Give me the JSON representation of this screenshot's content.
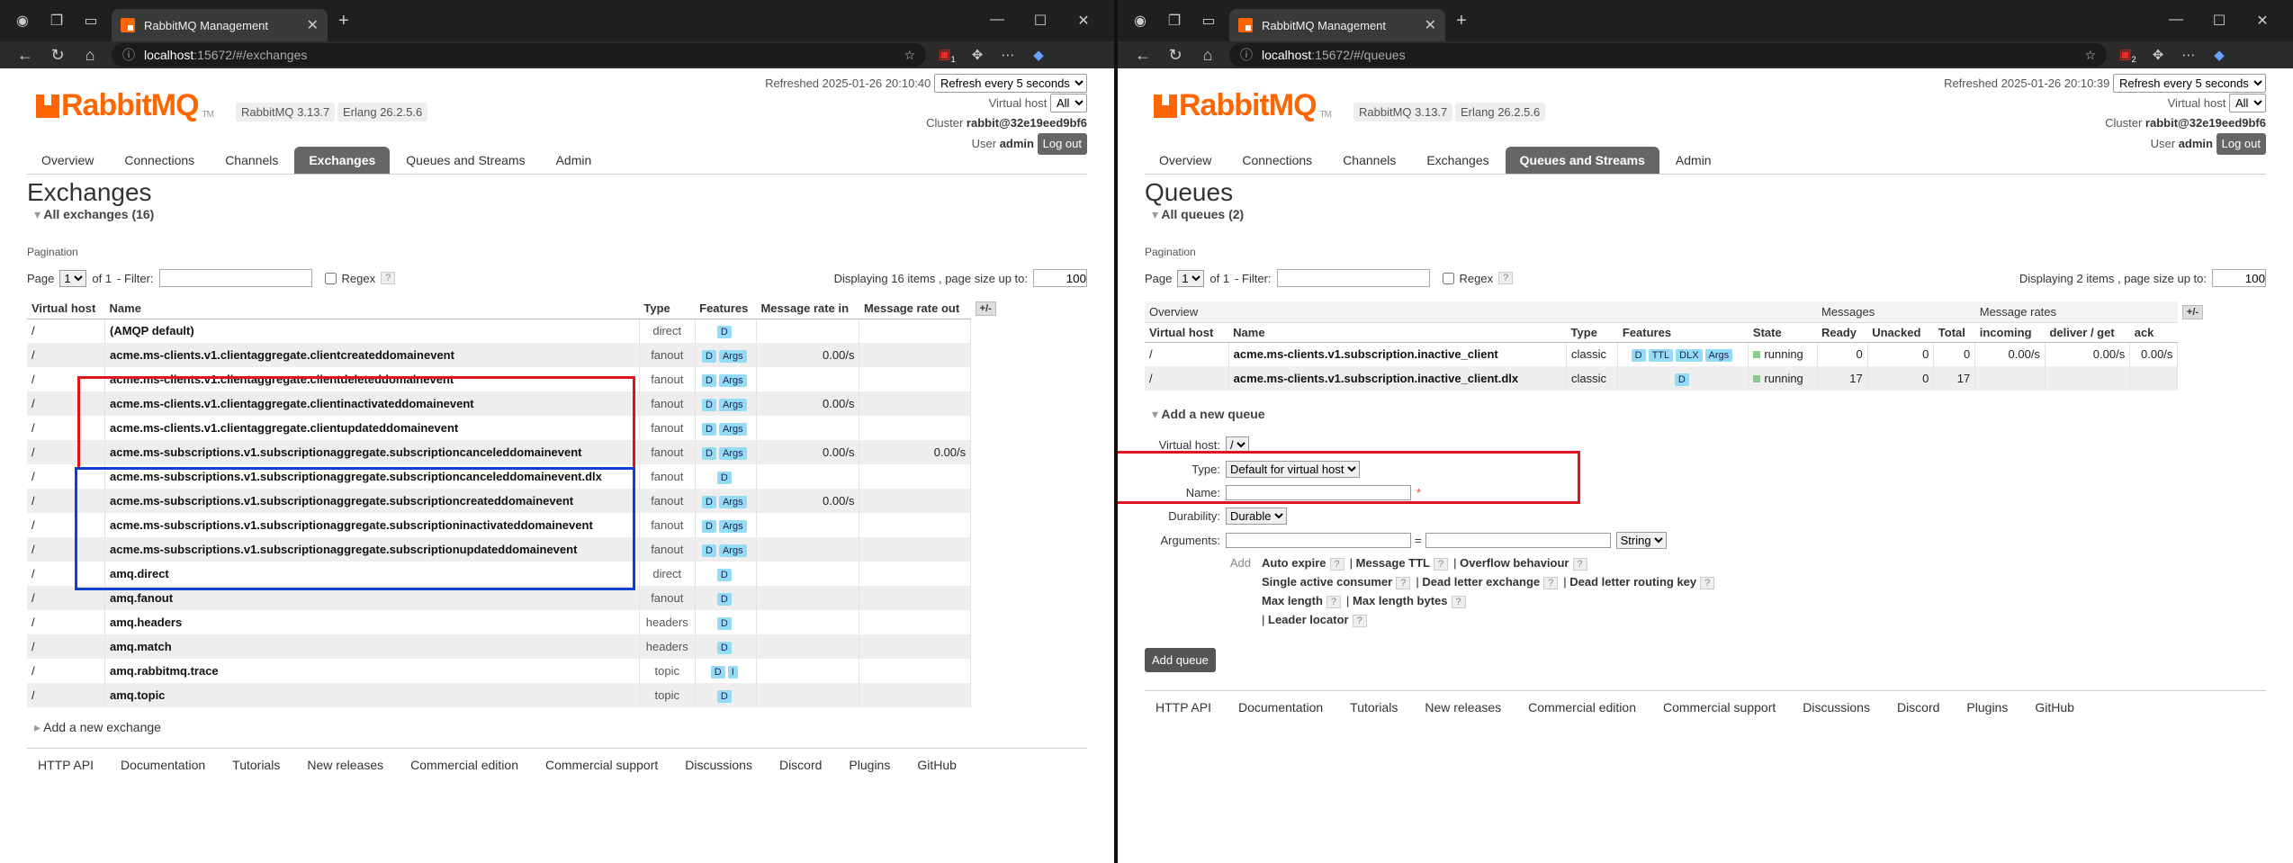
{
  "left": {
    "tab_title": "RabbitMQ Management",
    "url_host": "localhost",
    "url_rest": ":15672/#/exchanges",
    "ext_badge": "1",
    "version": "RabbitMQ 3.13.7",
    "erlang": "Erlang 26.2.5.6",
    "refreshed": "Refreshed 2025-01-26 20:10:40",
    "refresh_option": "Refresh every 5 seconds",
    "vhost_label": "Virtual host",
    "vhost_option": "All",
    "cluster_label": "Cluster",
    "cluster": "rabbit@32e19eed9bf6",
    "user_label": "User",
    "user": "admin",
    "logout": "Log out",
    "nav": [
      "Overview",
      "Connections",
      "Channels",
      "Exchanges",
      "Queues and Streams",
      "Admin"
    ],
    "page_title": "Exchanges",
    "section": "All exchanges (16)",
    "pagination": "Pagination",
    "page_label": "Page",
    "page_value": "1",
    "of_label": "of 1",
    "filter_label": "- Filter:",
    "regex_label": "Regex",
    "q": "?",
    "display_text": "Displaying 16 items , page size up to:",
    "page_size": "100",
    "columns": [
      "Virtual host",
      "Name",
      "Type",
      "Features",
      "Message rate in",
      "Message rate out",
      "+/-"
    ],
    "rows": [
      {
        "vh": "/",
        "name": "(AMQP default)",
        "type": "direct",
        "f": [
          "D"
        ],
        "in": "",
        "out": ""
      },
      {
        "vh": "/",
        "name": "acme.ms-clients.v1.clientaggregate.clientcreateddomainevent",
        "type": "fanout",
        "f": [
          "D",
          "Args"
        ],
        "in": "0.00/s",
        "out": ""
      },
      {
        "vh": "/",
        "name": "acme.ms-clients.v1.clientaggregate.clientdeleteddomainevent",
        "type": "fanout",
        "f": [
          "D",
          "Args"
        ],
        "in": "",
        "out": ""
      },
      {
        "vh": "/",
        "name": "acme.ms-clients.v1.clientaggregate.clientinactivateddomainevent",
        "type": "fanout",
        "f": [
          "D",
          "Args"
        ],
        "in": "0.00/s",
        "out": ""
      },
      {
        "vh": "/",
        "name": "acme.ms-clients.v1.clientaggregate.clientupdateddomainevent",
        "type": "fanout",
        "f": [
          "D",
          "Args"
        ],
        "in": "",
        "out": ""
      },
      {
        "vh": "/",
        "name": "acme.ms-subscriptions.v1.subscriptionaggregate.subscriptioncanceleddomainevent",
        "type": "fanout",
        "f": [
          "D",
          "Args"
        ],
        "in": "0.00/s",
        "out": "0.00/s"
      },
      {
        "vh": "/",
        "name": "acme.ms-subscriptions.v1.subscriptionaggregate.subscriptioncanceleddomainevent.dlx",
        "type": "fanout",
        "f": [
          "D"
        ],
        "in": "",
        "out": ""
      },
      {
        "vh": "/",
        "name": "acme.ms-subscriptions.v1.subscriptionaggregate.subscriptioncreateddomainevent",
        "type": "fanout",
        "f": [
          "D",
          "Args"
        ],
        "in": "0.00/s",
        "out": ""
      },
      {
        "vh": "/",
        "name": "acme.ms-subscriptions.v1.subscriptionaggregate.subscriptioninactivateddomainevent",
        "type": "fanout",
        "f": [
          "D",
          "Args"
        ],
        "in": "",
        "out": ""
      },
      {
        "vh": "/",
        "name": "acme.ms-subscriptions.v1.subscriptionaggregate.subscriptionupdateddomainevent",
        "type": "fanout",
        "f": [
          "D",
          "Args"
        ],
        "in": "",
        "out": ""
      },
      {
        "vh": "/",
        "name": "amq.direct",
        "type": "direct",
        "f": [
          "D"
        ],
        "in": "",
        "out": ""
      },
      {
        "vh": "/",
        "name": "amq.fanout",
        "type": "fanout",
        "f": [
          "D"
        ],
        "in": "",
        "out": ""
      },
      {
        "vh": "/",
        "name": "amq.headers",
        "type": "headers",
        "f": [
          "D"
        ],
        "in": "",
        "out": ""
      },
      {
        "vh": "/",
        "name": "amq.match",
        "type": "headers",
        "f": [
          "D"
        ],
        "in": "",
        "out": ""
      },
      {
        "vh": "/",
        "name": "amq.rabbitmq.trace",
        "type": "topic",
        "f": [
          "D",
          "I"
        ],
        "in": "",
        "out": ""
      },
      {
        "vh": "/",
        "name": "amq.topic",
        "type": "topic",
        "f": [
          "D"
        ],
        "in": "",
        "out": ""
      }
    ],
    "add_exchange": "Add a new exchange",
    "footer": [
      "HTTP API",
      "Documentation",
      "Tutorials",
      "New releases",
      "Commercial edition",
      "Commercial support",
      "Discussions",
      "Discord",
      "Plugins",
      "GitHub"
    ]
  },
  "right": {
    "tab_title": "RabbitMQ Management",
    "url_host": "localhost",
    "url_rest": ":15672/#/queues",
    "ext_badge": "2",
    "version": "RabbitMQ 3.13.7",
    "erlang": "Erlang 26.2.5.6",
    "refreshed": "Refreshed 2025-01-26 20:10:39",
    "refresh_option": "Refresh every 5 seconds",
    "vhost_label": "Virtual host",
    "vhost_option": "All",
    "cluster_label": "Cluster",
    "cluster": "rabbit@32e19eed9bf6",
    "user_label": "User",
    "user": "admin",
    "logout": "Log out",
    "nav": [
      "Overview",
      "Connections",
      "Channels",
      "Exchanges",
      "Queues and Streams",
      "Admin"
    ],
    "page_title": "Queues",
    "section": "All queues (2)",
    "pagination": "Pagination",
    "page_label": "Page",
    "page_value": "1",
    "of_label": "of 1",
    "filter_label": "- Filter:",
    "regex_label": "Regex",
    "q": "?",
    "display_text": "Displaying 2 items , page size up to:",
    "page_size": "100",
    "group_headers": [
      "Overview",
      "Messages",
      "Message rates",
      "+/-"
    ],
    "columns": [
      "Virtual host",
      "Name",
      "Type",
      "Features",
      "State",
      "Ready",
      "Unacked",
      "Total",
      "incoming",
      "deliver / get",
      "ack"
    ],
    "rows": [
      {
        "vh": "/",
        "name": "acme.ms-clients.v1.subscription.inactive_client",
        "type": "classic",
        "f": [
          "D",
          "TTL",
          "DLX",
          "Args"
        ],
        "state": "running",
        "ready": "0",
        "unacked": "0",
        "total": "0",
        "incoming": "0.00/s",
        "deliver": "0.00/s",
        "ack": "0.00/s"
      },
      {
        "vh": "/",
        "name": "acme.ms-clients.v1.subscription.inactive_client.dlx",
        "type": "classic",
        "f": [
          "D"
        ],
        "state": "running",
        "ready": "17",
        "unacked": "0",
        "total": "17",
        "incoming": "",
        "deliver": "",
        "ack": ""
      }
    ],
    "add_queue_section": "Add a new queue",
    "form": {
      "vhost_label": "Virtual host:",
      "vhost_value": "/",
      "type_label": "Type:",
      "type_value": "Default for virtual host",
      "name_label": "Name:",
      "name_required": "*",
      "durability_label": "Durability:",
      "durability_value": "Durable",
      "arguments_label": "Arguments:",
      "equals": "=",
      "arg_type": "String",
      "add_label": "Add",
      "arg_keys": [
        [
          "Auto expire",
          "Message TTL",
          "Overflow behaviour"
        ],
        [
          "Single active consumer",
          "Dead letter exchange",
          "Dead letter routing key"
        ],
        [
          "Max length",
          "Max length bytes"
        ],
        [
          "Leader locator"
        ]
      ],
      "add_button": "Add queue"
    },
    "footer": [
      "HTTP API",
      "Documentation",
      "Tutorials",
      "New releases",
      "Commercial edition",
      "Commercial support",
      "Discussions",
      "Discord",
      "Plugins",
      "GitHub"
    ]
  },
  "colors": {
    "highlight_red": "#e0141e",
    "highlight_blue": "#1040d0",
    "brand_orange": "#ff6600"
  }
}
